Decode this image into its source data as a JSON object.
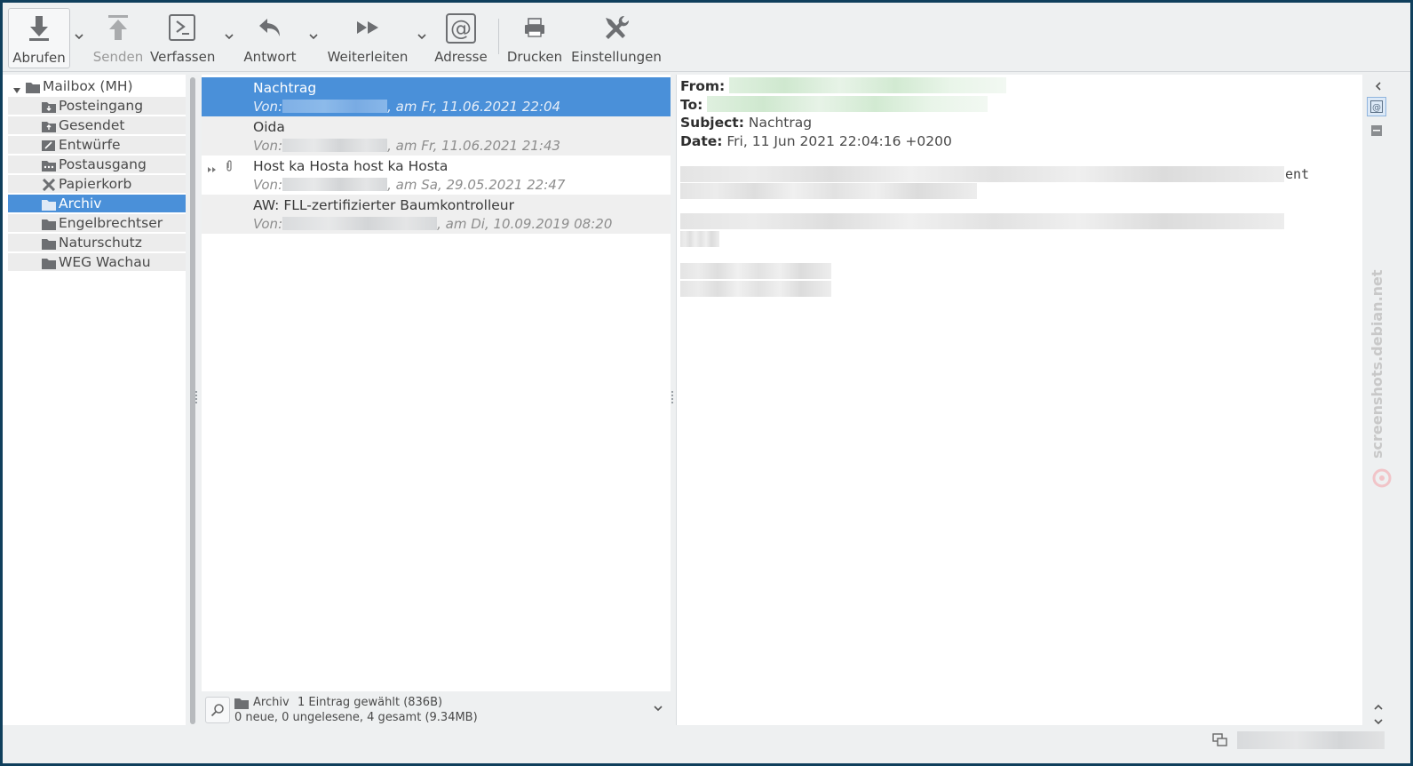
{
  "toolbar": {
    "fetch": "Abrufen",
    "send": "Senden",
    "compose": "Verfassen",
    "reply": "Antwort",
    "forward": "Weiterleiten",
    "address": "Adresse",
    "print": "Drucken",
    "settings": "Einstellungen"
  },
  "folders": {
    "root": "Mailbox (MH)",
    "items": [
      {
        "label": "Posteingang",
        "icon": "inbox-icon"
      },
      {
        "label": "Gesendet",
        "icon": "sent-icon"
      },
      {
        "label": "Entwürfe",
        "icon": "drafts-icon"
      },
      {
        "label": "Postausgang",
        "icon": "outbox-icon"
      },
      {
        "label": "Papierkorb",
        "icon": "trash-icon"
      },
      {
        "label": "Archiv",
        "icon": "folder-icon"
      },
      {
        "label": "Engelbrechtser",
        "icon": "folder-icon"
      },
      {
        "label": "Naturschutz",
        "icon": "folder-icon"
      },
      {
        "label": "WEG Wachau",
        "icon": "folder-icon"
      }
    ],
    "selected": "Archiv"
  },
  "messages": [
    {
      "subject": "Nachtrag",
      "from_prefix": "Von:",
      "date": ", am Fr, 11.06.2021 22:04"
    },
    {
      "subject": "Oida",
      "from_prefix": "Von:",
      "date": ", am Fr, 11.06.2021 21:43"
    },
    {
      "subject": "Host ka Hosta host ka Hosta",
      "from_prefix": "Von:",
      "date": ", am Sa, 29.05.2021 22:47"
    },
    {
      "subject": "AW: FLL-zertifizierter Baumkontrolleur",
      "from_prefix": "Von:",
      "date": ", am Di, 10.09.2019 08:20"
    }
  ],
  "status": {
    "folder": "Archiv",
    "selection": "1 Eintrag gewählt (836B)",
    "counts": "0 neue, 0 ungelesene, 4 gesamt (9.34MB)"
  },
  "viewer": {
    "from_label": "From:",
    "to_label": "To:",
    "subject_label": "Subject:",
    "subject": "Nachtrag",
    "date_label": "Date:",
    "date": "Fri, 11 Jun 2021 22:04:16 +0200",
    "body_tail": "ent"
  },
  "watermark": "screenshots.debian.net",
  "colors": {
    "selection": "#4a90d9",
    "toolbar_bg": "#eef0f1",
    "window_border": "#0f3f5c"
  }
}
